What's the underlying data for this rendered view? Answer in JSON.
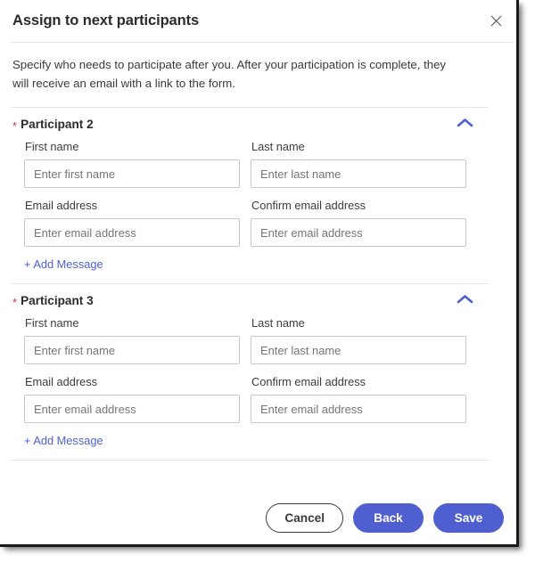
{
  "dialog": {
    "title": "Assign to next participants",
    "close_icon": "close-icon",
    "description": "Specify who needs to participate after you. After your participation is complete, they will receive an email with a link to the form."
  },
  "participants": [
    {
      "required_marker": "*",
      "title": "Participant 2",
      "collapse_icon": "chevron-up-icon",
      "fields": {
        "first_name": {
          "label": "First name",
          "value": "",
          "placeholder": "Enter first name"
        },
        "last_name": {
          "label": "Last name",
          "value": "",
          "placeholder": "Enter last name"
        },
        "email": {
          "label": "Email address",
          "value": "",
          "placeholder": "Enter email address"
        },
        "confirm_email": {
          "label": "Confirm email address",
          "value": "",
          "placeholder": "Enter email address"
        }
      },
      "add_message_label": "+ Add Message"
    },
    {
      "required_marker": "*",
      "title": "Participant 3",
      "collapse_icon": "chevron-up-icon",
      "fields": {
        "first_name": {
          "label": "First name",
          "value": "",
          "placeholder": "Enter first name"
        },
        "last_name": {
          "label": "Last name",
          "value": "",
          "placeholder": "Enter last name"
        },
        "email": {
          "label": "Email address",
          "value": "",
          "placeholder": "Enter email address"
        },
        "confirm_email": {
          "label": "Confirm email address",
          "value": "",
          "placeholder": "Enter email address"
        }
      },
      "add_message_label": "+ Add Message"
    }
  ],
  "footer": {
    "cancel_label": "Cancel",
    "back_label": "Back",
    "save_label": "Save"
  },
  "colors": {
    "accent": "#4f5fd0",
    "required": "#d0364a",
    "text": "#2b2b2b",
    "border": "#c9c9c9",
    "divider": "#e6e6e6"
  }
}
